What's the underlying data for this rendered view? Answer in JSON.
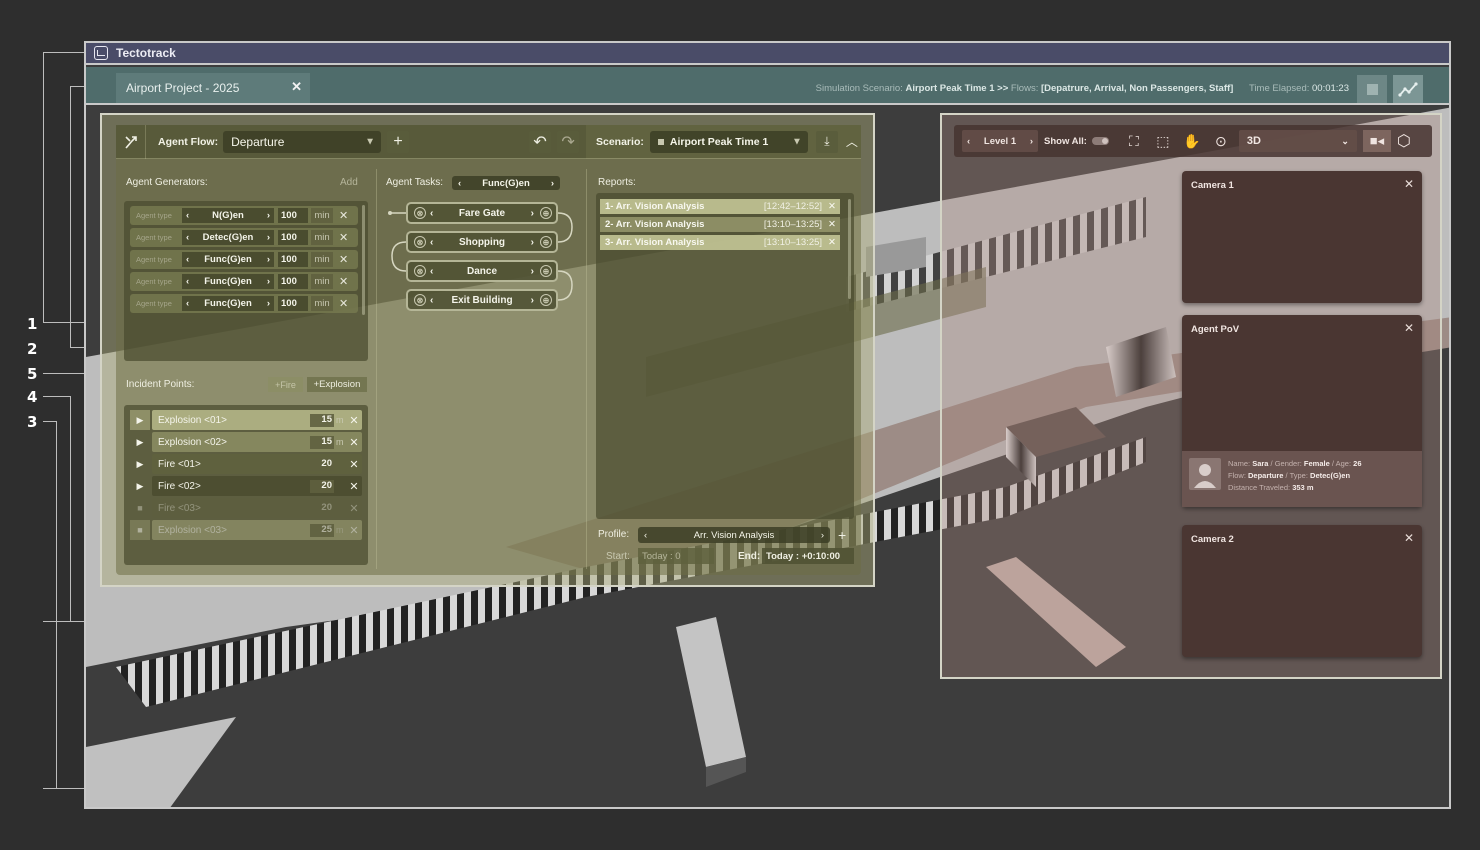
{
  "callouts": [
    "1",
    "2",
    "5",
    "4",
    "3"
  ],
  "app": {
    "title": "Tectotrack"
  },
  "tabbar": {
    "project_tab": "Airport Project - 2025",
    "sim_label": "Simulation Scenario:",
    "sim_value": "Airport Peak Time 1 >>",
    "flows_label": "Flows:",
    "flows_value": "[Depatrure, Arrival, Non Passengers, Staff]",
    "elapsed_label": "Time Elapsed:",
    "elapsed_value": "00:01:23"
  },
  "left_panel": {
    "agent_flow_label": "Agent Flow:",
    "agent_flow_value": "Departure",
    "scenario_label": "Scenario:",
    "scenario_value": "Airport Peak Time 1",
    "generators": {
      "title": "Agent Generators:",
      "add_label": "Add",
      "rows": [
        {
          "type_label": "Agent type",
          "name": "N(G)en",
          "value": "100",
          "unit": "min"
        },
        {
          "type_label": "Agent type",
          "name": "Detec(G)en",
          "value": "100",
          "unit": "min"
        },
        {
          "type_label": "Agent type",
          "name": "Func(G)en",
          "value": "100",
          "unit": "min"
        },
        {
          "type_label": "Agent type",
          "name": "Func(G)en",
          "value": "100",
          "unit": "min"
        },
        {
          "type_label": "Agent type",
          "name": "Func(G)en",
          "value": "100",
          "unit": "min"
        }
      ]
    },
    "tasks": {
      "title": "Agent Tasks:",
      "selected": "Func(G)en",
      "rows": [
        "Fare Gate",
        "Shopping",
        "Dance",
        "Exit Building"
      ]
    },
    "reports": {
      "title": "Reports:",
      "rows": [
        {
          "name": "1- Arr. Vision Analysis",
          "time": "[12:42–12:52]"
        },
        {
          "name": "2- Arr. Vision Analysis",
          "time": "[13:10–13:25]"
        },
        {
          "name": "3- Arr. Vision Analysis",
          "time": "[13:10–13:25]"
        }
      ],
      "profile_label": "Profile:",
      "profile_value": "Arr. Vision Analysis",
      "start_label": "Start:",
      "start_value": "Today : 0",
      "end_label": "End:",
      "end_value": "Today : +0:10:00"
    },
    "incidents": {
      "title": "Incident Points:",
      "add_fire": "+Fire",
      "add_explosion": "+Explosion",
      "rows": [
        {
          "name": "Explosion <01>",
          "value": "15",
          "unit": "m"
        },
        {
          "name": "Explosion <02>",
          "value": "15",
          "unit": "m"
        },
        {
          "name": "Fire <01>",
          "value": "20",
          "unit": ""
        },
        {
          "name": "Fire <02>",
          "value": "20",
          "unit": ""
        },
        {
          "name": "Fire <03>",
          "value": "20",
          "unit": ""
        },
        {
          "name": "Explosion <03>",
          "value": "25",
          "unit": "m"
        }
      ]
    }
  },
  "right_panel": {
    "level": "Level 1",
    "show_all": "Show All:",
    "view_mode": "3D",
    "cameras": [
      {
        "title": "Camera 1"
      },
      {
        "title": "Agent PoV"
      },
      {
        "title": "Camera 2"
      }
    ],
    "pov": {
      "name_label": "Name:",
      "name": "Sara",
      "gender_label": "/ Gender:",
      "gender": "Female",
      "age_label": "/ Age:",
      "age": "26",
      "flow_label": "Flow:",
      "flow": "Departure",
      "type_label": "/ Type:",
      "type": "Detec(G)en",
      "dist_label": "Distance Traveled:",
      "dist": "353 m"
    }
  },
  "colors": {
    "titlebar": "#4a4c68",
    "tabbar": "#4f6c6b",
    "left_panel_tint": "#a9a978",
    "right_panel_tint": "#aa877d"
  }
}
